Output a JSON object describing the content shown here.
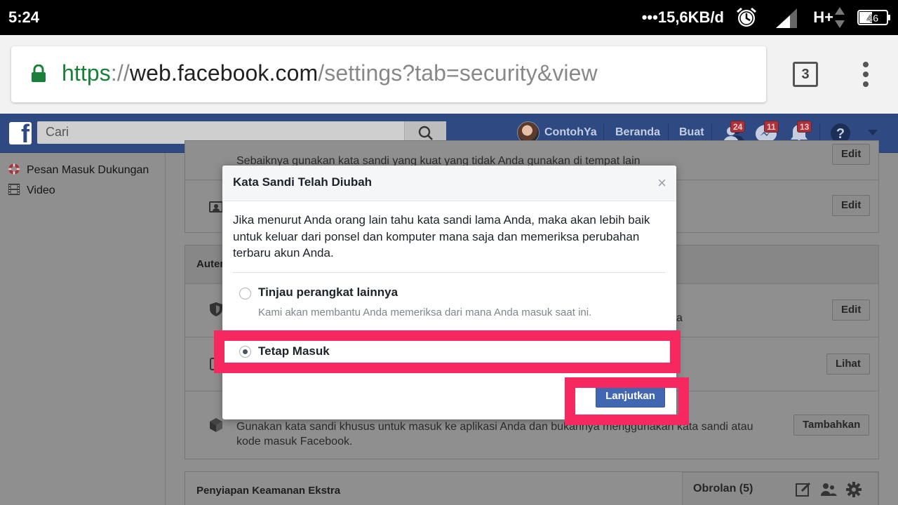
{
  "status_bar": {
    "time": "5:24",
    "net_speed": "15,6KB/d",
    "network_type": "H+",
    "battery": "46"
  },
  "browser": {
    "url_scheme": "https",
    "url_sep": "://",
    "url_host": "web.facebook.com",
    "url_path": "/settings?tab=security&view",
    "tab_count": "3"
  },
  "facebook_nav": {
    "search_placeholder": "Cari",
    "user_name": "ContohYa",
    "home_label": "Beranda",
    "create_label": "Buat",
    "friend_requests_badge": "24",
    "messages_badge": "11",
    "notifications_badge": "13"
  },
  "sidebar": {
    "items": [
      {
        "label": "Pesan Masuk Dukungan",
        "icon": "lifebuoy-icon"
      },
      {
        "label": "Video",
        "icon": "film-icon"
      }
    ]
  },
  "background": {
    "row1_text": "Sebaiknya gunakan kata sandi yang kuat yang tidak Anda gunakan di tempat lain",
    "row1_button": "Edit",
    "row2_button": "Edit",
    "section_auth_title": "Auten",
    "row3_button": "Edit",
    "row3_trail": "a",
    "row4_button": "Lihat",
    "row5_text": "Gunakan kata sandi khusus untuk masuk ke aplikasi Anda dan bukannya menggunakan kata sandi atau kode masuk Facebook.",
    "row5_button": "Tambahkan",
    "section_extra_title": "Penyiapan Keamanan Ekstra"
  },
  "chat": {
    "label": "Obrolan (5)"
  },
  "modal": {
    "title": "Kata Sandi Telah Diubah",
    "close": "×",
    "body": "Jika menurut Anda orang lain tahu kata sandi lama Anda, maka akan lebih baik untuk keluar dari ponsel dan komputer mana saja dan memeriksa perubahan terbaru akun Anda.",
    "options": [
      {
        "title": "Tinjau perangkat lainnya",
        "description": "Kami akan membantu Anda memeriksa dari mana Anda masuk saat ini.",
        "selected": false
      },
      {
        "title": "Tetap Masuk",
        "description": "",
        "selected": true
      }
    ],
    "continue_button": "Lanjutkan"
  },
  "colors": {
    "facebook_blue": "#4267b2",
    "nav_blue": "#2f4a83",
    "highlight": "#f72860",
    "https_green": "#188038"
  }
}
